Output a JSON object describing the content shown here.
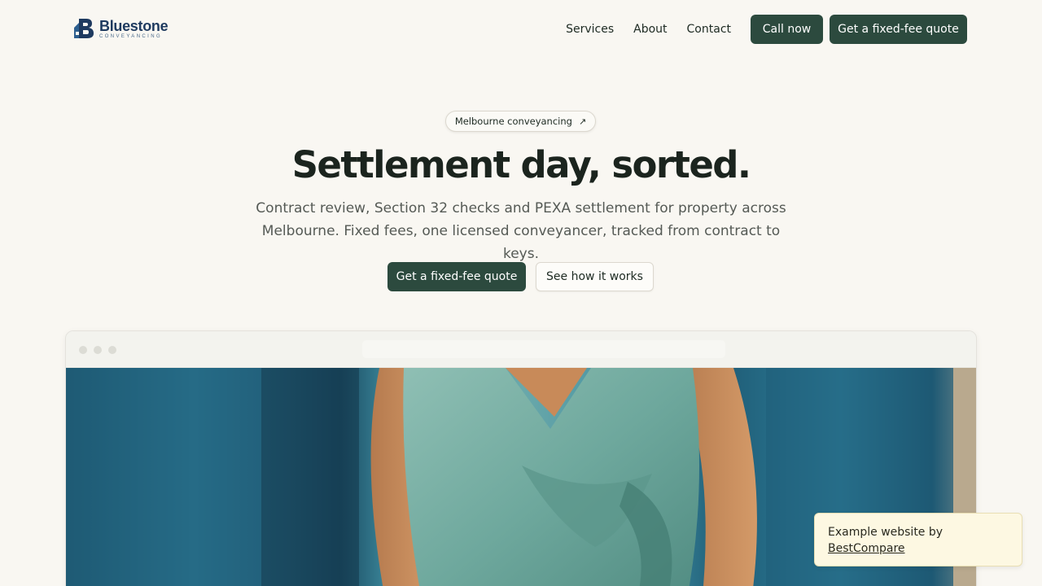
{
  "brand": {
    "name": "Bluestone",
    "tagline": "CONVEYANCING",
    "logo_icon": "house-b-icon",
    "primary_color": "#1e3a5f"
  },
  "nav": {
    "links": [
      "Services",
      "About",
      "Contact"
    ],
    "call_label": "Call now",
    "quote_label": "Get a fixed-fee quote",
    "button_color": "#2c4a3e"
  },
  "hero": {
    "pill_label": "Melbourne conveyancing",
    "pill_icon": "arrow-up-right-icon",
    "headline": "Settlement day, sorted.",
    "subheadline_line1": "Contract review, Section 32 checks and PEXA settlement for property across",
    "subheadline_line2": "Melbourne. Fixed fees, one licensed conveyancer, tracked from contract to keys.",
    "primary_cta": "Get a fixed-fee quote",
    "secondary_cta": "See how it works"
  },
  "badge": {
    "text": "Example website by",
    "link": "BestCompare"
  }
}
